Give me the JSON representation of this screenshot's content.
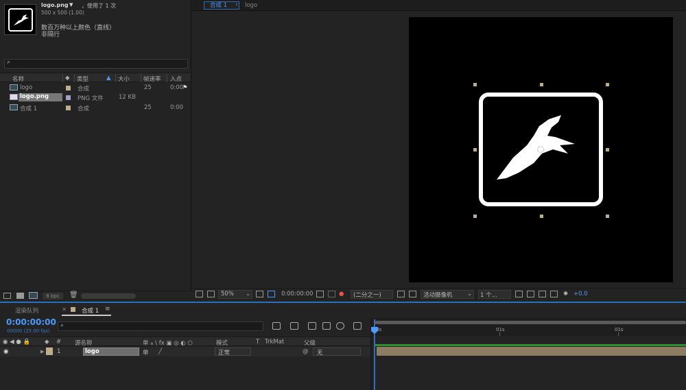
{
  "project": {
    "item_name": "logo.png",
    "item_dropdown": "▼",
    "item_used": "，使用了 1 次",
    "item_dimensions": "500 x 500 (1.00)",
    "item_color": "数百万种以上颜色（直线）",
    "item_interlace": "非隔行",
    "search_icon": "⌕",
    "columns": {
      "name": "名称",
      "type": "类型",
      "size": "大小",
      "fps": "帧速率",
      "in": "入点"
    },
    "rows": [
      {
        "name": "logo",
        "type": "合成",
        "size": "",
        "fps": "25",
        "in": "0:00",
        "swatch": "#bfae8a"
      },
      {
        "name": "logo.png",
        "type": "PNG 文件",
        "size": "12 KB",
        "fps": "",
        "in": "",
        "swatch": "#a0a0c8"
      },
      {
        "name": "合成 1",
        "type": "合成",
        "size": "",
        "fps": "25",
        "in": "0:00",
        "swatch": "#bfae8a"
      }
    ],
    "bpc": "8 bpc"
  },
  "comp": {
    "tab_label": "合成 1",
    "tab_chevron": "‹",
    "breadcrumb": "logo",
    "zoom": "50%",
    "timecode": "0:00:00:00",
    "resolution": "(二分之一)",
    "camera": "活动摄像机",
    "views": "1 个...",
    "exposure": "+0.0"
  },
  "timeline": {
    "render_queue_tab": "渲染队列",
    "close_x": "×",
    "comp_tab": "合成 1",
    "menu": "≡",
    "timecode": "0:00:00:00",
    "fps_label": "00000 (25.00 fps)",
    "search_icon": "⌕",
    "ruler": [
      "0s",
      "01s",
      "01s"
    ],
    "headers": {
      "num": "#",
      "source": "源名称",
      "switches": "单 ⁎ \\ fx ▣ ◎ ◐ ⬡",
      "mode": "模式",
      "t": "T",
      "trkmat": "TrkMat",
      "parent": "父级"
    },
    "layer": {
      "index": "1",
      "name": "logo",
      "switch": "单",
      "mode": "正常",
      "parent": "无"
    }
  },
  "colors": {
    "accent": "#2a6fc4",
    "label": "#bfae8a",
    "layer_bar": "#8d7d63"
  }
}
